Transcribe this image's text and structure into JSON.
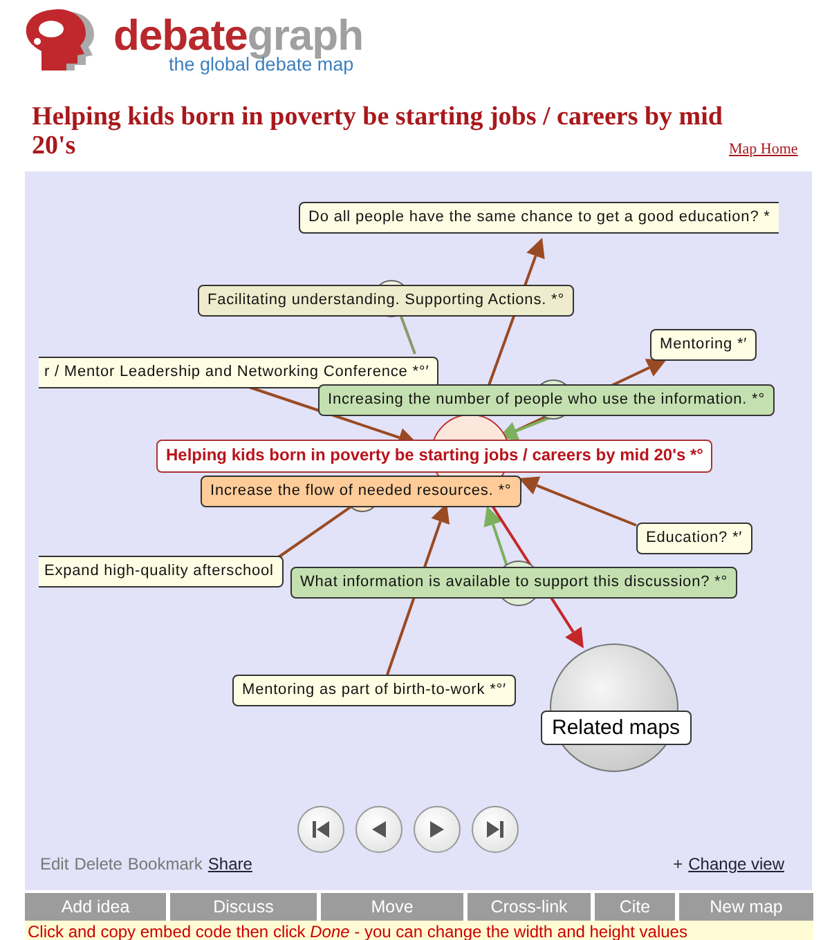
{
  "logo": {
    "brand_parts": [
      "debate",
      "graph"
    ],
    "tagline": "the global debate map"
  },
  "title": "Helping kids born in poverty be starting jobs / careers by mid 20's",
  "home_link": "Map Home",
  "map": {
    "nodes": [
      {
        "kind": "idea",
        "label": "Do all people have the same chance to get a good education? *"
      },
      {
        "kind": "position",
        "label": "Facilitating understanding. Supporting Actions. *°"
      },
      {
        "kind": "idea",
        "label": "Mentoring *′"
      },
      {
        "kind": "idea",
        "label": "r / Mentor Leadership and Networking Conference *°′"
      },
      {
        "kind": "support",
        "label": "Increasing the number of people who use the information. *°"
      },
      {
        "kind": "focus",
        "label": "Helping kids born in poverty be starting jobs / careers by mid 20's *°"
      },
      {
        "kind": "action",
        "label": "Increase the flow of needed resources. *°"
      },
      {
        "kind": "idea",
        "label": "Education? *′"
      },
      {
        "kind": "idea",
        "label": "Expand high-quality afterschool"
      },
      {
        "kind": "support",
        "label": "What information is available to support this discussion? *°"
      },
      {
        "kind": "idea",
        "label": "Mentoring as part of birth-to-work *°′"
      }
    ],
    "related": "Related maps"
  },
  "actions": [
    {
      "kind": "plain",
      "label": "Edit"
    },
    {
      "kind": "plain",
      "label": "Delete"
    },
    {
      "kind": "plain",
      "label": "Bookmark"
    },
    {
      "kind": "link",
      "label": "Share"
    }
  ],
  "view_link": {
    "prefix": "+",
    "label": "Change view"
  },
  "toolbar": [
    "Add idea",
    "Discuss",
    "Move",
    "Cross-link",
    "Cite",
    "New map"
  ],
  "message": "Click and copy embed code then click *Done* - you can change the width and height values"
}
